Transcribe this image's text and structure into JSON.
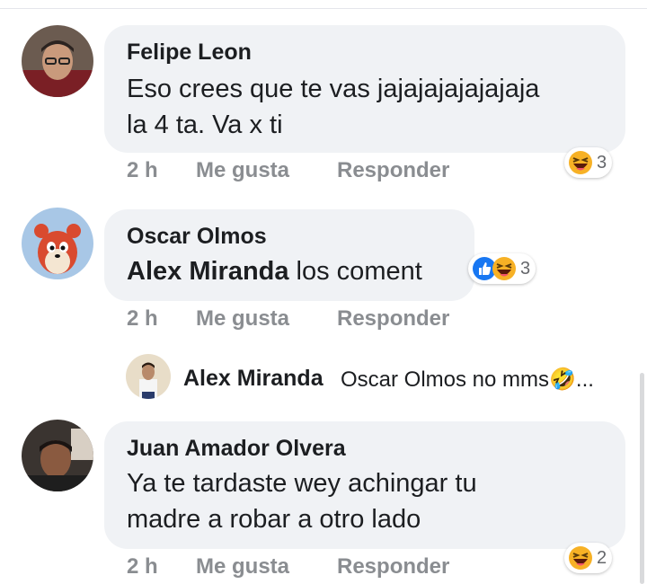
{
  "comments": [
    {
      "author": "Felipe Leon",
      "text_line1": "Eso crees que te vas jajajajajajajaja",
      "text_line2": "la 4 ta. Va x ti",
      "time": "2 h",
      "like_label": "Me gusta",
      "reply_label": "Responder",
      "reaction_count": "3"
    },
    {
      "author": "Oscar Olmos",
      "mention": "Alex Miranda",
      "text": " los coment",
      "time": "2 h",
      "like_label": "Me gusta",
      "reply_label": "Responder",
      "reaction_count": "3",
      "reply": {
        "author": "Alex Miranda",
        "text": "Oscar Olmos no mms🤣..."
      }
    },
    {
      "author": "Juan Amador Olvera",
      "text_line1": "Ya te tardaste wey  achingar tu",
      "text_line2": "madre  a robar a otro lado",
      "time": "2 h",
      "like_label": "Me gusta",
      "reply_label": "Responder",
      "reaction_count": "2"
    }
  ],
  "icons": {
    "haha": "haha-reaction-icon",
    "like": "like-reaction-icon"
  },
  "colors": {
    "bubble": "#f0f2f5",
    "meta_text": "#8a8d91",
    "like_blue": "#1877f2",
    "haha_yellow": "#f7b125"
  }
}
